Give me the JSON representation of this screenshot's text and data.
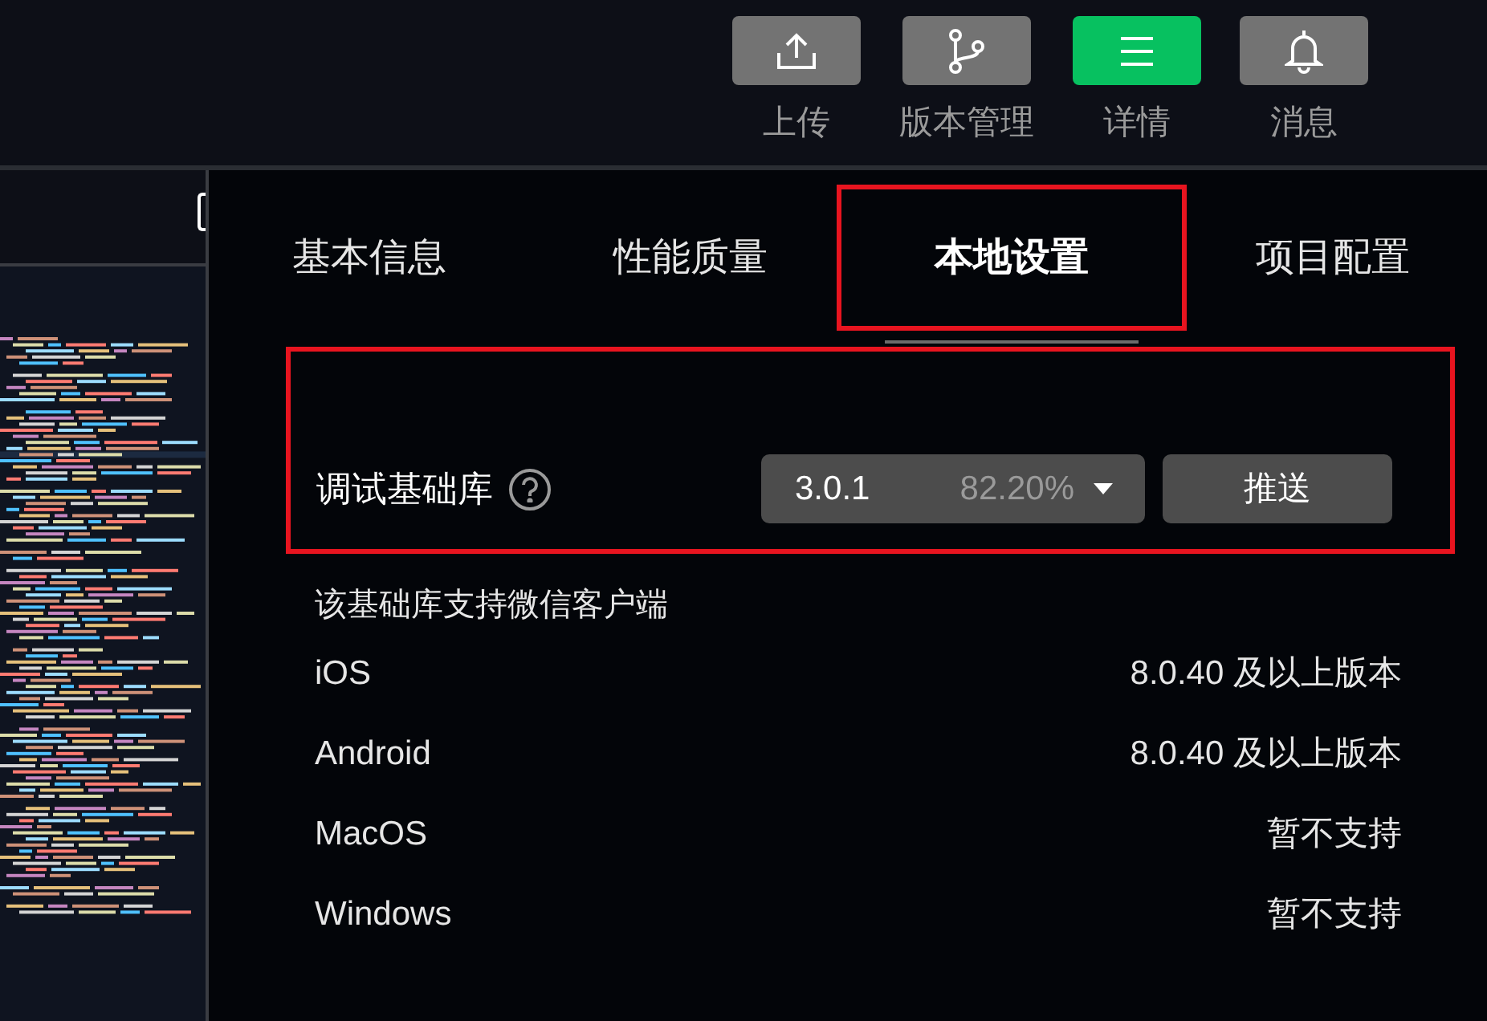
{
  "toolbar": [
    {
      "label": "上传",
      "kind": "upload",
      "selected": false
    },
    {
      "label": "版本管理",
      "kind": "branch",
      "selected": false
    },
    {
      "label": "详情",
      "kind": "menu",
      "selected": true
    },
    {
      "label": "消息",
      "kind": "bell",
      "selected": false
    }
  ],
  "tabs": [
    {
      "label": "基本信息",
      "selected": false,
      "highlighted": false
    },
    {
      "label": "性能质量",
      "selected": false,
      "highlighted": false
    },
    {
      "label": "本地设置",
      "selected": true,
      "highlighted": true
    },
    {
      "label": "项目配置",
      "selected": false,
      "highlighted": false
    }
  ],
  "base_library": {
    "label": "调试基础库",
    "version": "3.0.1",
    "share": "82.20%",
    "button": "推送",
    "highlighted": true
  },
  "support": {
    "heading": "该基础库支持微信客户端",
    "rows": [
      {
        "platform": "iOS",
        "requirement": "8.0.40 及以上版本"
      },
      {
        "platform": "Android",
        "requirement": "8.0.40 及以上版本"
      },
      {
        "platform": "MacOS",
        "requirement": "暂不支持"
      },
      {
        "platform": "Windows",
        "requirement": "暂不支持"
      }
    ]
  }
}
